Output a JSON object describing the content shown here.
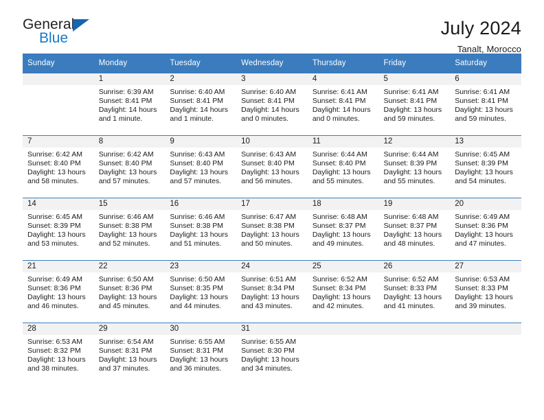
{
  "brand": {
    "name_top": "General",
    "name_bottom": "Blue",
    "triangle_icon": "triangle-icon",
    "colors": {
      "blue": "#1878c8",
      "dark": "#231f20",
      "triangle": "#1565b0"
    }
  },
  "header": {
    "title": "July 2024",
    "subtitle": "Tanalt, Morocco"
  },
  "calendar": {
    "accent_color": "#3a7cbe",
    "weekday_headers": [
      "Sunday",
      "Monday",
      "Tuesday",
      "Wednesday",
      "Thursday",
      "Friday",
      "Saturday"
    ],
    "weeks": [
      [
        {
          "day": ""
        },
        {
          "day": "1",
          "sunrise": "Sunrise: 6:39 AM",
          "sunset": "Sunset: 8:41 PM",
          "daylight": "Daylight: 14 hours and 1 minute."
        },
        {
          "day": "2",
          "sunrise": "Sunrise: 6:40 AM",
          "sunset": "Sunset: 8:41 PM",
          "daylight": "Daylight: 14 hours and 1 minute."
        },
        {
          "day": "3",
          "sunrise": "Sunrise: 6:40 AM",
          "sunset": "Sunset: 8:41 PM",
          "daylight": "Daylight: 14 hours and 0 minutes."
        },
        {
          "day": "4",
          "sunrise": "Sunrise: 6:41 AM",
          "sunset": "Sunset: 8:41 PM",
          "daylight": "Daylight: 14 hours and 0 minutes."
        },
        {
          "day": "5",
          "sunrise": "Sunrise: 6:41 AM",
          "sunset": "Sunset: 8:41 PM",
          "daylight": "Daylight: 13 hours and 59 minutes."
        },
        {
          "day": "6",
          "sunrise": "Sunrise: 6:41 AM",
          "sunset": "Sunset: 8:41 PM",
          "daylight": "Daylight: 13 hours and 59 minutes."
        }
      ],
      [
        {
          "day": "7",
          "sunrise": "Sunrise: 6:42 AM",
          "sunset": "Sunset: 8:40 PM",
          "daylight": "Daylight: 13 hours and 58 minutes."
        },
        {
          "day": "8",
          "sunrise": "Sunrise: 6:42 AM",
          "sunset": "Sunset: 8:40 PM",
          "daylight": "Daylight: 13 hours and 57 minutes."
        },
        {
          "day": "9",
          "sunrise": "Sunrise: 6:43 AM",
          "sunset": "Sunset: 8:40 PM",
          "daylight": "Daylight: 13 hours and 57 minutes."
        },
        {
          "day": "10",
          "sunrise": "Sunrise: 6:43 AM",
          "sunset": "Sunset: 8:40 PM",
          "daylight": "Daylight: 13 hours and 56 minutes."
        },
        {
          "day": "11",
          "sunrise": "Sunrise: 6:44 AM",
          "sunset": "Sunset: 8:40 PM",
          "daylight": "Daylight: 13 hours and 55 minutes."
        },
        {
          "day": "12",
          "sunrise": "Sunrise: 6:44 AM",
          "sunset": "Sunset: 8:39 PM",
          "daylight": "Daylight: 13 hours and 55 minutes."
        },
        {
          "day": "13",
          "sunrise": "Sunrise: 6:45 AM",
          "sunset": "Sunset: 8:39 PM",
          "daylight": "Daylight: 13 hours and 54 minutes."
        }
      ],
      [
        {
          "day": "14",
          "sunrise": "Sunrise: 6:45 AM",
          "sunset": "Sunset: 8:39 PM",
          "daylight": "Daylight: 13 hours and 53 minutes."
        },
        {
          "day": "15",
          "sunrise": "Sunrise: 6:46 AM",
          "sunset": "Sunset: 8:38 PM",
          "daylight": "Daylight: 13 hours and 52 minutes."
        },
        {
          "day": "16",
          "sunrise": "Sunrise: 6:46 AM",
          "sunset": "Sunset: 8:38 PM",
          "daylight": "Daylight: 13 hours and 51 minutes."
        },
        {
          "day": "17",
          "sunrise": "Sunrise: 6:47 AM",
          "sunset": "Sunset: 8:38 PM",
          "daylight": "Daylight: 13 hours and 50 minutes."
        },
        {
          "day": "18",
          "sunrise": "Sunrise: 6:48 AM",
          "sunset": "Sunset: 8:37 PM",
          "daylight": "Daylight: 13 hours and 49 minutes."
        },
        {
          "day": "19",
          "sunrise": "Sunrise: 6:48 AM",
          "sunset": "Sunset: 8:37 PM",
          "daylight": "Daylight: 13 hours and 48 minutes."
        },
        {
          "day": "20",
          "sunrise": "Sunrise: 6:49 AM",
          "sunset": "Sunset: 8:36 PM",
          "daylight": "Daylight: 13 hours and 47 minutes."
        }
      ],
      [
        {
          "day": "21",
          "sunrise": "Sunrise: 6:49 AM",
          "sunset": "Sunset: 8:36 PM",
          "daylight": "Daylight: 13 hours and 46 minutes."
        },
        {
          "day": "22",
          "sunrise": "Sunrise: 6:50 AM",
          "sunset": "Sunset: 8:36 PM",
          "daylight": "Daylight: 13 hours and 45 minutes."
        },
        {
          "day": "23",
          "sunrise": "Sunrise: 6:50 AM",
          "sunset": "Sunset: 8:35 PM",
          "daylight": "Daylight: 13 hours and 44 minutes."
        },
        {
          "day": "24",
          "sunrise": "Sunrise: 6:51 AM",
          "sunset": "Sunset: 8:34 PM",
          "daylight": "Daylight: 13 hours and 43 minutes."
        },
        {
          "day": "25",
          "sunrise": "Sunrise: 6:52 AM",
          "sunset": "Sunset: 8:34 PM",
          "daylight": "Daylight: 13 hours and 42 minutes."
        },
        {
          "day": "26",
          "sunrise": "Sunrise: 6:52 AM",
          "sunset": "Sunset: 8:33 PM",
          "daylight": "Daylight: 13 hours and 41 minutes."
        },
        {
          "day": "27",
          "sunrise": "Sunrise: 6:53 AM",
          "sunset": "Sunset: 8:33 PM",
          "daylight": "Daylight: 13 hours and 39 minutes."
        }
      ],
      [
        {
          "day": "28",
          "sunrise": "Sunrise: 6:53 AM",
          "sunset": "Sunset: 8:32 PM",
          "daylight": "Daylight: 13 hours and 38 minutes."
        },
        {
          "day": "29",
          "sunrise": "Sunrise: 6:54 AM",
          "sunset": "Sunset: 8:31 PM",
          "daylight": "Daylight: 13 hours and 37 minutes."
        },
        {
          "day": "30",
          "sunrise": "Sunrise: 6:55 AM",
          "sunset": "Sunset: 8:31 PM",
          "daylight": "Daylight: 13 hours and 36 minutes."
        },
        {
          "day": "31",
          "sunrise": "Sunrise: 6:55 AM",
          "sunset": "Sunset: 8:30 PM",
          "daylight": "Daylight: 13 hours and 34 minutes."
        },
        {
          "day": ""
        },
        {
          "day": ""
        },
        {
          "day": ""
        }
      ]
    ]
  }
}
